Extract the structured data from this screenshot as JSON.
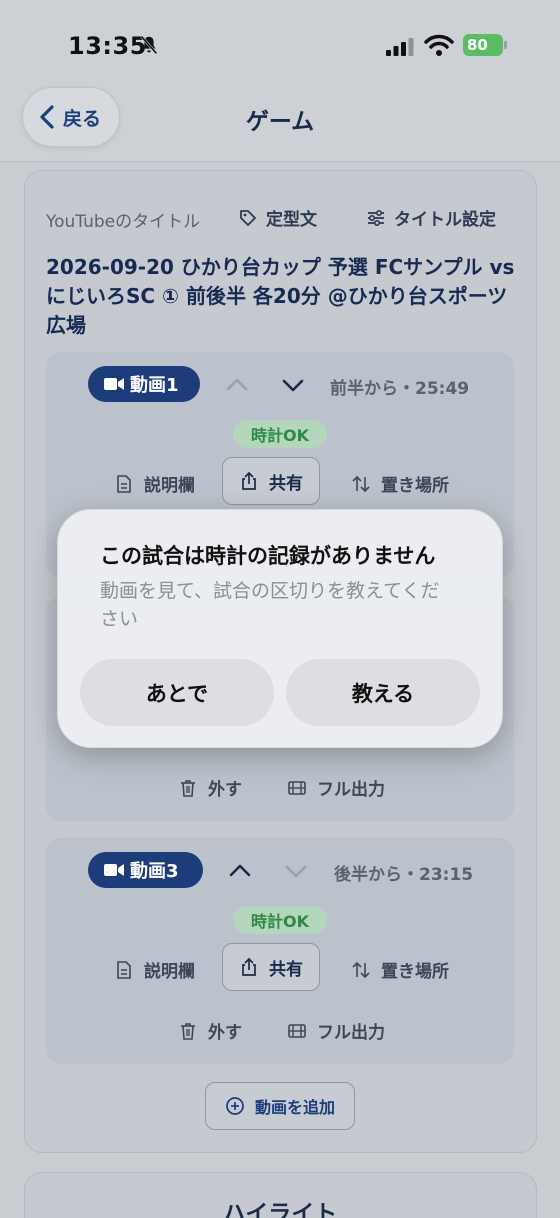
{
  "status_bar": {
    "time": "13:35",
    "battery": "80"
  },
  "nav": {
    "back_label": "戻る",
    "title": "ゲーム"
  },
  "youtube": {
    "label": "YouTubeのタイトル",
    "template_label": "定型文",
    "title_settings_label": "タイトル設定",
    "title": "2026-09-20 ひかり台カップ 予選 FCサンプル vs にじいろSC ① 前後半 各20分 @ひかり台スポーツ広場"
  },
  "videos": [
    {
      "badge": "動画1",
      "time_label": "前半から・25:49",
      "clock_status": "時計OK",
      "description_label": "説明欄",
      "share_label": "共有",
      "location_label": "置き場所"
    },
    {
      "remove_label": "外す",
      "full_export_label": "フル出力"
    },
    {
      "badge": "動画3",
      "time_label": "後半から・23:15",
      "clock_status": "時計OK",
      "description_label": "説明欄",
      "share_label": "共有",
      "location_label": "置き場所",
      "remove_label": "外す",
      "full_export_label": "フル出力"
    }
  ],
  "add_video_label": "動画を追加",
  "highlight_title": "ハイライト",
  "dialog": {
    "title": "この試合は時計の記録がありません",
    "message": "動画を見て、試合の区切りを教えてください",
    "later_label": "あとで",
    "teach_label": "教える"
  },
  "colors": {
    "accent": "#1d3c7a",
    "ok_green": "#2c8a45",
    "battery": "#5bbd63"
  }
}
